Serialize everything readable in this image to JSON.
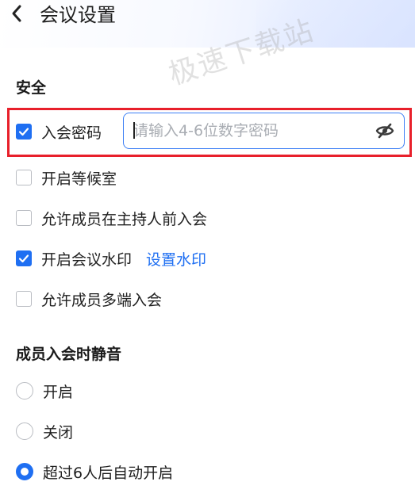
{
  "header": {
    "title": "会议设置"
  },
  "watermark": "极速下载站",
  "security": {
    "title": "安全",
    "password": {
      "label": "入会密码",
      "checked": true,
      "placeholder": "请输入4-6位数字密码",
      "value": ""
    },
    "options": [
      {
        "label": "开启等候室",
        "checked": false
      },
      {
        "label": "允许成员在主持人前入会",
        "checked": false
      },
      {
        "label": "开启会议水印",
        "checked": true,
        "link": "设置水印"
      },
      {
        "label": "允许成员多端入会",
        "checked": false
      }
    ]
  },
  "mute": {
    "title": "成员入会时静音",
    "options": [
      {
        "label": "开启",
        "selected": false
      },
      {
        "label": "关闭",
        "selected": false
      },
      {
        "label": "超过6人后自动开启",
        "selected": true
      }
    ]
  },
  "colors": {
    "accent": "#1f6ff2",
    "highlight_border": "#e8202b"
  },
  "icons": {
    "back": "chevron-left-icon",
    "password_visibility": "eye-off-icon",
    "check": "check-icon"
  }
}
